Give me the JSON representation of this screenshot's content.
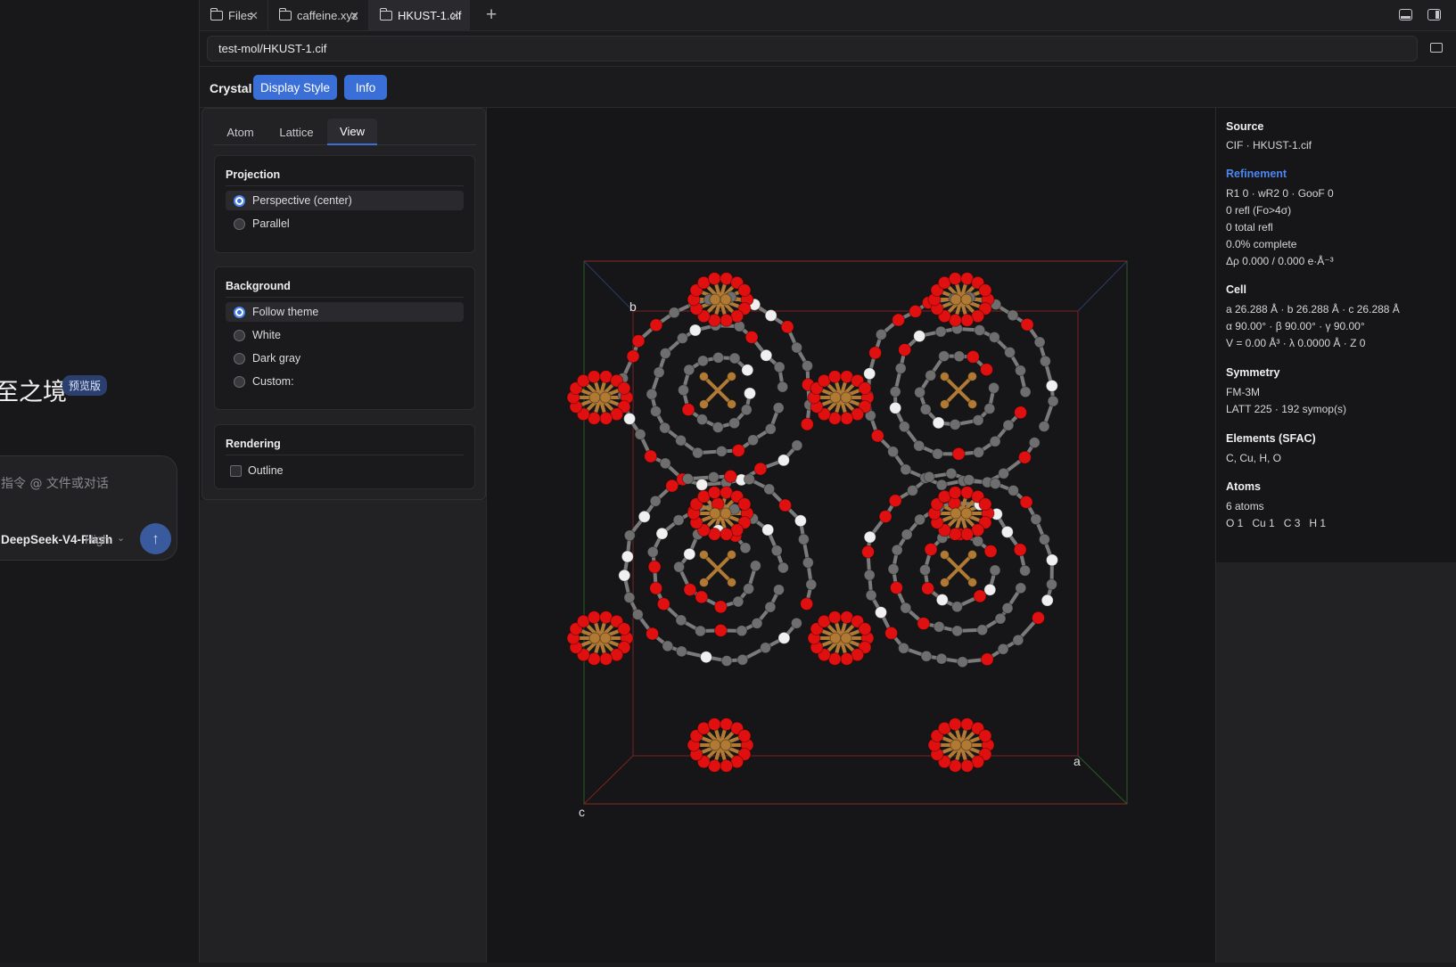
{
  "sidebar": {
    "brand_text": "至之境",
    "brand_badge": "预览版",
    "chat_placeholder": "指令 @ 文件或对话",
    "model_name": "DeepSeek-V4-Flash",
    "model_level": "High",
    "chevron_glyph": "⌄",
    "send_glyph": "↑"
  },
  "tabs": [
    {
      "label": "Files",
      "close": "✕"
    },
    {
      "label": "caffeine.xyz",
      "close": "✕"
    },
    {
      "label": "HKUST-1.cif",
      "close": "✕"
    }
  ],
  "add_tab_glyph": "+",
  "path": {
    "value": "test-mol/HKUST-1.cif"
  },
  "toolbar": {
    "title": "Crystal",
    "display_style_label": "Display Style",
    "info_label": "Info"
  },
  "settings": {
    "tabs": [
      "Atom",
      "Lattice",
      "View"
    ],
    "active_tab": "View",
    "projection": {
      "title": "Projection",
      "options": [
        "Perspective (center)",
        "Parallel"
      ],
      "selected": "Perspective (center)"
    },
    "background": {
      "title": "Background",
      "options": [
        "Follow theme",
        "White",
        "Dark gray",
        "Custom:"
      ],
      "selected": "Follow theme"
    },
    "rendering": {
      "title": "Rendering",
      "outline_label": "Outline",
      "outline_checked": false
    }
  },
  "viewport": {
    "axis_a": "a",
    "axis_b": "b",
    "axis_c": "c"
  },
  "info": {
    "source_title": "Source",
    "source_value": "CIF · HKUST-1.cif",
    "refinement_title": "Refinement",
    "refinement_lines": [
      "R1 0 · wR2 0 · GooF 0",
      "0 refl (Fo>4σ)",
      "0 total refl",
      "0.0% complete",
      "Δρ 0.000 / 0.000 e·Å⁻³"
    ],
    "cell_title": "Cell",
    "cell_lines": [
      "a 26.288 Å · b 26.288 Å · c 26.288 Å",
      "α 90.00° · β 90.00° · γ 90.00°",
      "V = 0.00 Å³ · λ 0.0000 Å · Z 0"
    ],
    "symmetry_title": "Symmetry",
    "symmetry_lines": [
      "FM-3M",
      "LATT 225 · 192 symop(s)"
    ],
    "elements_title": "Elements (SFAC)",
    "elements_value": "C, Cu, H, O",
    "atoms_title": "Atoms",
    "atoms_count": "6 atoms",
    "atoms_breakdown": "O 1   Cu 1   C 3   H 1"
  },
  "colors": {
    "accent": "#3a6fd8",
    "oxygen": "#e01010",
    "copper": "#b07a35",
    "carbon": "#6e6e6e",
    "hydrogen": "#f0f0f0"
  }
}
